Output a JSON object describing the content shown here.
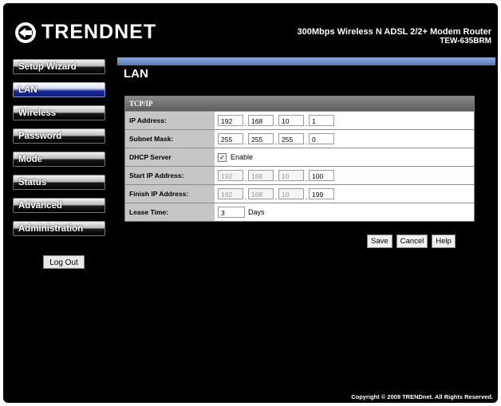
{
  "header": {
    "brand": "TRENDNET",
    "product": "300Mbps Wireless N ADSL 2/2+ Modem Router",
    "model": "TEW-635BRM",
    "brand_icon": "trendnet-logo-icon"
  },
  "sidebar": {
    "items": [
      {
        "label": "Setup Wizard"
      },
      {
        "label": "LAN"
      },
      {
        "label": "Wireless"
      },
      {
        "label": "Password"
      },
      {
        "label": "Mode"
      },
      {
        "label": "Status"
      },
      {
        "label": "Advanced"
      },
      {
        "label": "Administration"
      }
    ],
    "active": "LAN",
    "logout_label": "Log Out"
  },
  "main": {
    "title": "LAN",
    "section": "TCP/IP",
    "ip_label": "IP Address:",
    "ip": [
      "192",
      "168",
      "10",
      "1"
    ],
    "mask_label": "Subnet Mask:",
    "mask": [
      "255",
      "255",
      "255",
      "0"
    ],
    "dhcp_label": "DHCP Server",
    "dhcp_enable_label": "Enable",
    "dhcp_checked": true,
    "start_label": "Start IP Address:",
    "start_ip": [
      "192",
      "168",
      "10",
      "100"
    ],
    "finish_label": "Finish IP Address:",
    "finish_ip": [
      "192",
      "168",
      "10",
      "199"
    ],
    "lease_label": "Lease Time:",
    "lease_value": "3",
    "lease_unit": "Days",
    "save_label": "Save",
    "cancel_label": "Cancel",
    "help_label": "Help"
  },
  "footer": {
    "copyright": "Copyright © 2009 TRENDnet. All Rights Reserved."
  },
  "colors": {
    "background": "#000000",
    "active_nav": "#101c7a",
    "content_bar": "#5a78b8"
  }
}
